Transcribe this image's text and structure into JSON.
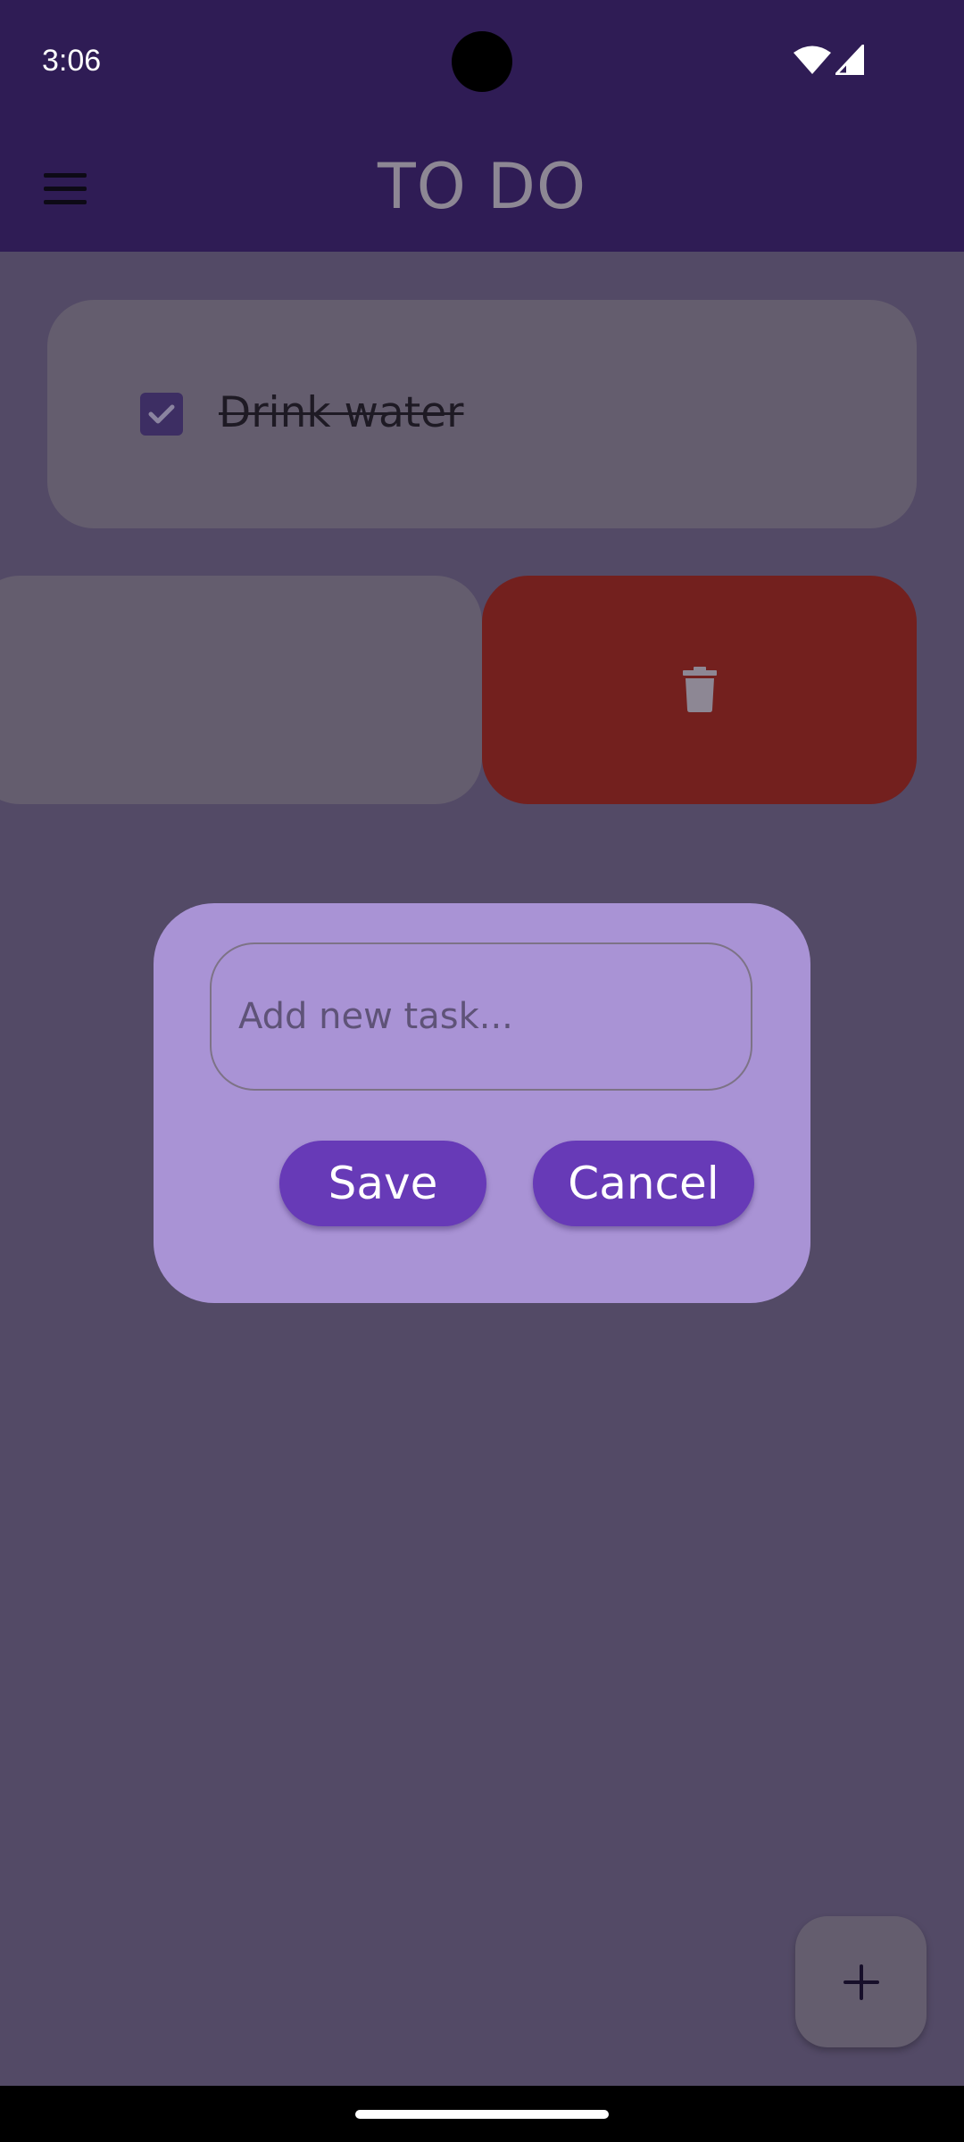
{
  "status_bar": {
    "time": "3:06",
    "icons": [
      "wifi-icon",
      "signal-icon"
    ]
  },
  "app_bar": {
    "menu_icon": "menu-icon",
    "title": "TO DO"
  },
  "tasks": [
    {
      "label": "Drink water",
      "completed": true
    }
  ],
  "swipe_action": {
    "icon": "trash-icon",
    "color": "#73201e"
  },
  "dialog": {
    "input_placeholder": "Add new task...",
    "input_value": "",
    "save_label": "Save",
    "cancel_label": "Cancel"
  },
  "fab": {
    "icon": "plus-icon"
  },
  "colors": {
    "app_bar": "#2f1c55",
    "accent": "#673ab7",
    "dialog": "#a993d5",
    "delete": "#73201e"
  }
}
